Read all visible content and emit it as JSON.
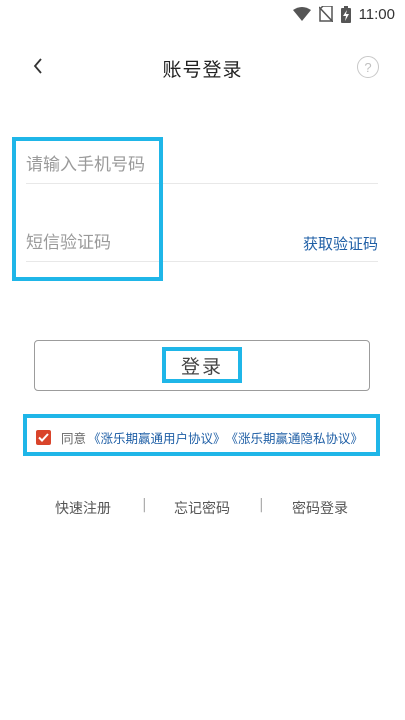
{
  "status_bar": {
    "time": "11:00"
  },
  "header": {
    "title": "账号登录",
    "help_symbol": "?"
  },
  "form": {
    "phone_placeholder": "请输入手机号码",
    "code_placeholder": "短信验证码",
    "get_code_label": "获取验证码",
    "login_label": "登录"
  },
  "agreement": {
    "checked": true,
    "prefix": "同意",
    "user_agreement": "《涨乐期赢通用户协议》",
    "privacy_agreement": "《涨乐期赢通隐私协议》"
  },
  "bottom_links": {
    "quick_register": "快速注册",
    "forgot_password": "忘记密码",
    "password_login": "密码登录",
    "separator": "|"
  },
  "colors": {
    "highlight": "#1fb6e8",
    "link": "#1f5fa6",
    "checkbox": "#d9442b"
  }
}
